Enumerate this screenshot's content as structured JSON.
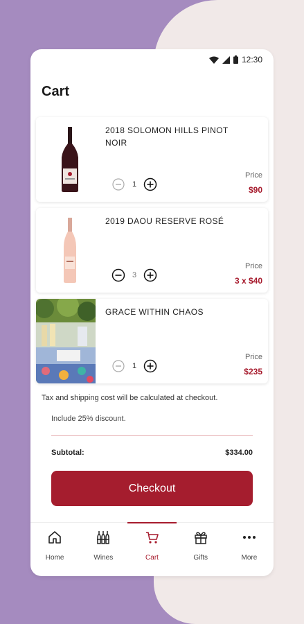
{
  "status_bar": {
    "time": "12:30"
  },
  "page": {
    "title": "Cart"
  },
  "cart": {
    "items": [
      {
        "name": "2018 SOLOMON HILLS PINOT NOIR",
        "quantity": "1",
        "price_label": "Price",
        "price": "$90"
      },
      {
        "name": "2019 DAOU RESERVE ROSÉ",
        "quantity": "3",
        "price_label": "Price",
        "price": "3 x $40"
      },
      {
        "name": "GRACE WITHIN CHAOS",
        "quantity": "1",
        "price_label": "Price",
        "price": "$235"
      }
    ],
    "tax_note": "Tax and shipping cost will be calculated at checkout.",
    "discount_note": "Include 25% discount.",
    "subtotal_label": "Subtotal:",
    "subtotal_value": "$334.00",
    "checkout_label": "Checkout"
  },
  "nav": {
    "items": [
      {
        "label": "Home",
        "icon": "home-icon"
      },
      {
        "label": "Wines",
        "icon": "wines-icon"
      },
      {
        "label": "Cart",
        "icon": "cart-icon"
      },
      {
        "label": "Gifts",
        "icon": "gift-icon"
      },
      {
        "label": "More",
        "icon": "more-icon"
      }
    ],
    "active": "Cart"
  },
  "colors": {
    "accent": "#a51d2e",
    "background": "#a58bbf",
    "panel": "#f1e9e8"
  }
}
